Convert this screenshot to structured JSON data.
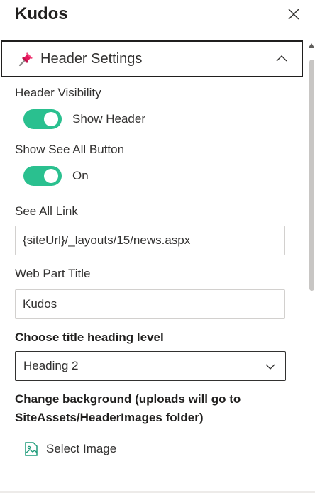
{
  "panel": {
    "title": "Kudos",
    "close_icon": "close-icon"
  },
  "section": {
    "icon": "pushpin-icon",
    "label": "Header Settings",
    "expanded": true
  },
  "header_visibility": {
    "label": "Header Visibility",
    "toggle_on": true,
    "toggle_text": "Show Header"
  },
  "see_all_button": {
    "label": "Show See All Button",
    "toggle_on": true,
    "toggle_text": "On"
  },
  "see_all_link": {
    "label": "See All Link",
    "value": "{siteUrl}/_layouts/15/news.aspx"
  },
  "web_part_title": {
    "label": "Web Part Title",
    "value": "Kudos"
  },
  "heading_level": {
    "label": "Choose title heading level",
    "selected": "Heading 2"
  },
  "background": {
    "label_line1": "Change background (uploads will go to",
    "label_line2": "SiteAssets/HeaderImages folder)",
    "select_label": "Select Image"
  },
  "colors": {
    "toggle_on": "#2ac08f",
    "image_icon": "#1f9c7a",
    "pushpin": "#e8175d"
  }
}
